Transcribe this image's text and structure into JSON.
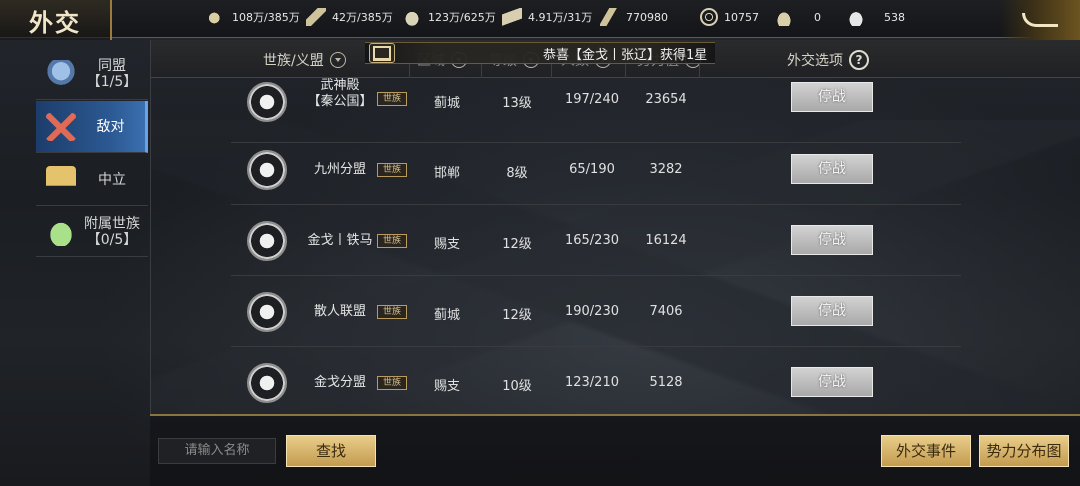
{
  "topbar": {
    "title": "外交",
    "resources": [
      {
        "icon": "wheat-icon",
        "value": "108万/385万"
      },
      {
        "icon": "wood-icon",
        "value": "42万/385万"
      },
      {
        "icon": "stone-icon",
        "value": "123万/625万"
      },
      {
        "icon": "iron-icon",
        "value": "4.91万/31万"
      },
      {
        "icon": "scroll-icon",
        "value": "770980"
      },
      {
        "icon": "coin-icon",
        "value": "10757"
      },
      {
        "icon": "gold-ingot-icon",
        "value": "0"
      },
      {
        "icon": "silver-ingot-icon",
        "value": "538"
      }
    ]
  },
  "sidebar": {
    "items": [
      {
        "label": "同盟\n【1/5】",
        "icon": "alliance-icon",
        "active": false
      },
      {
        "label": "敌对",
        "icon": "crossed-swords-icon",
        "active": true
      },
      {
        "label": "中立",
        "icon": "banner-icon",
        "active": false
      },
      {
        "label": "附属世族\n【0/5】",
        "icon": "vassal-icon",
        "active": false
      }
    ]
  },
  "table": {
    "headers": {
      "clan": "世族/义盟",
      "region": "区域",
      "level": "等级",
      "members": "人数",
      "power": "势力值",
      "options": "外交选项"
    },
    "ticker": "恭喜【金戈丨张辽】获得1星",
    "rows": [
      {
        "name": "武神殿\n【秦公国】",
        "tag": "世族",
        "region": "蓟城",
        "level": "13级",
        "members": "197/240",
        "power": "23654",
        "action": "停战"
      },
      {
        "name": "九州分盟",
        "tag": "世族",
        "region": "邯郸",
        "level": "8级",
        "members": "65/190",
        "power": "3282",
        "action": "停战"
      },
      {
        "name": "金戈丨铁马",
        "tag": "世族",
        "region": "赐支",
        "level": "12级",
        "members": "165/230",
        "power": "16124",
        "action": "停战"
      },
      {
        "name": "散人联盟",
        "tag": "世族",
        "region": "蓟城",
        "level": "12级",
        "members": "190/230",
        "power": "7406",
        "action": "停战"
      },
      {
        "name": "金戈分盟",
        "tag": "世族",
        "region": "赐支",
        "level": "10级",
        "members": "123/210",
        "power": "5128",
        "action": "停战"
      }
    ]
  },
  "bottombar": {
    "search_placeholder": "请输入名称",
    "search_button": "查找",
    "events_button": "外交事件",
    "map_button": "势力分布图"
  }
}
